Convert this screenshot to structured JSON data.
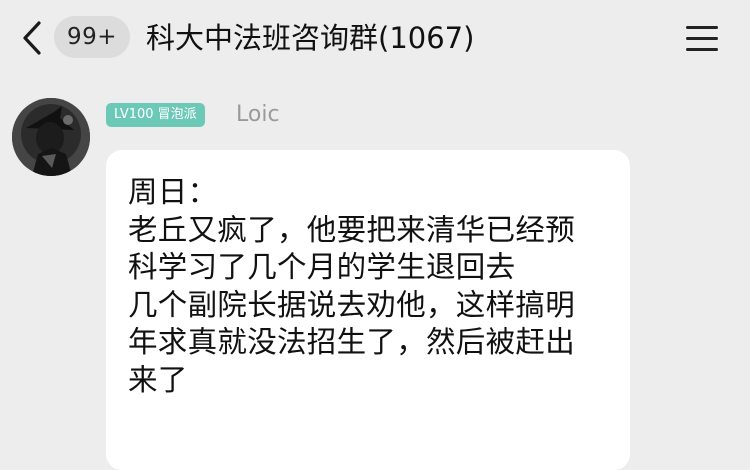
{
  "header": {
    "back_icon": "chevron-left-icon",
    "unread_badge": "99+",
    "title": "科大中法班咨询群(1067)",
    "menu_icon": "hamburger-menu-icon"
  },
  "message": {
    "sender": {
      "avatar": "avatar-dark-figure",
      "level_badge": "LV100 冒泡派",
      "nickname": "Loic"
    },
    "lines": [
      "周日：",
      "老丘又疯了，他要把来清华已经预",
      "科学习了几个月的学生退回去",
      "几个副院长据说去劝他，这样搞明",
      "年求真就没法招生了，然后被赶出",
      "来了"
    ]
  },
  "colors": {
    "background": "#ededed",
    "bubble": "#ffffff",
    "level_badge": "#6cc9b8",
    "unread_badge": "#dcdcdc"
  }
}
